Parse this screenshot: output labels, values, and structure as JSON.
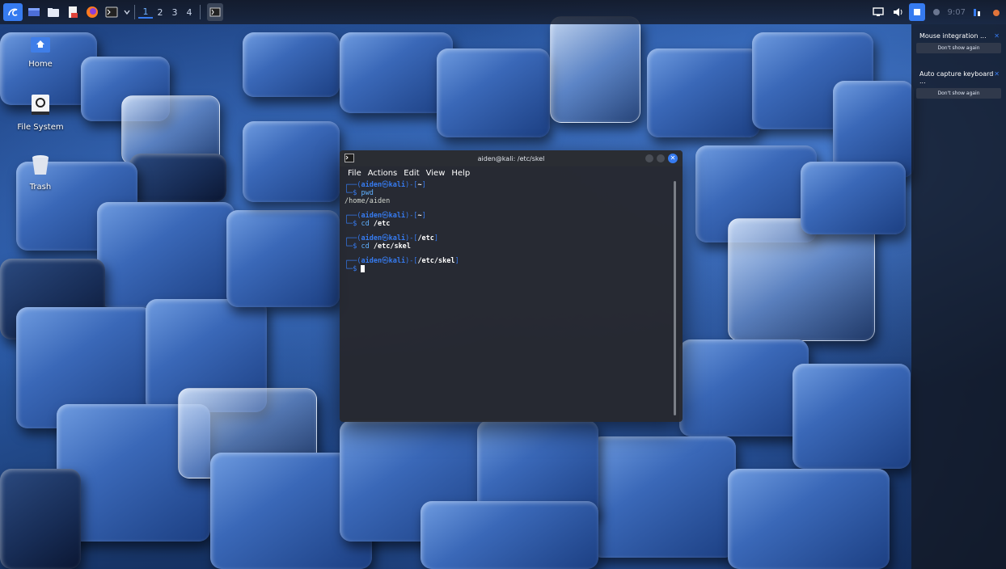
{
  "taskbar": {
    "workspaces": [
      "1",
      "2",
      "3",
      "4"
    ],
    "clock": "9:07"
  },
  "desktop_icons": [
    {
      "label": "Home"
    },
    {
      "label": "File System"
    },
    {
      "label": "Trash"
    }
  ],
  "terminal": {
    "title": "aiden@kali: /etc/skel",
    "menu": [
      "File",
      "Actions",
      "Edit",
      "View",
      "Help"
    ],
    "user": "aiden",
    "at": "㉿",
    "host": "kali",
    "blocks": [
      {
        "path": "~",
        "command": "pwd",
        "output": "/home/aiden"
      },
      {
        "path": "~",
        "command": "cd",
        "arg": "/etc",
        "output": ""
      },
      {
        "path": "/etc",
        "command": "cd",
        "arg": "/etc/skel",
        "output": ""
      },
      {
        "path": "/etc/skel",
        "command": "",
        "arg": "",
        "output": ""
      }
    ]
  },
  "notifications": [
    {
      "title": "Mouse integration ...",
      "button": "Don't show again"
    },
    {
      "title": "Auto capture keyboard ...",
      "button": "Don't show again"
    }
  ],
  "colors": {
    "kali_blue": "#367bf0",
    "terminal_bg": "#26282e",
    "panel_bg": "#121826"
  }
}
